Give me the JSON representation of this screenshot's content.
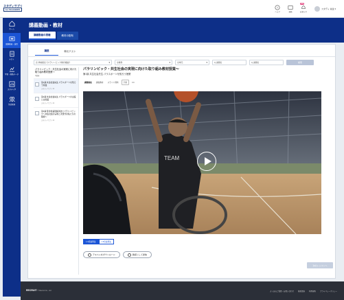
{
  "app": {
    "logo_line1": "スタディサプリ",
    "logo_line2": "for TEACHERS"
  },
  "topbar": {
    "icons": [
      {
        "name": "help-icon",
        "label": "ヘルプ"
      },
      {
        "name": "message-icon",
        "label": "連絡"
      },
      {
        "name": "notification-icon",
        "label": "お知らせ"
      }
    ],
    "badge": "999",
    "user_name": "スタディ 先生 ▾"
  },
  "sidebar": {
    "items": [
      {
        "label": "ホーム",
        "active": false
      },
      {
        "label": "講義動画・演習",
        "active": true
      },
      {
        "label": "テスト",
        "active": false
      },
      {
        "label": "学習・進路データ",
        "active": false
      },
      {
        "label": "スタディ学",
        "active": false
      },
      {
        "label": "生徒管理",
        "active": false
      }
    ]
  },
  "header": {
    "title": "講義動画・教材",
    "tabs": [
      {
        "label": "講義動画の視聴",
        "active": true
      },
      {
        "label": "教材の配布",
        "active": false
      }
    ]
  },
  "content_tabs": [
    {
      "label": "講座",
      "active": true
    },
    {
      "label": "単元テスト",
      "active": false
    }
  ],
  "filters": {
    "course": "高 学校探究【パラリンピック教育推進】",
    "f2": "全教科",
    "f3": "全単元",
    "q1": "Q 講座名",
    "q2": "Q 講座名",
    "search": "検索"
  },
  "left_list": {
    "course_title": "パラリンピック・共生社会の実現に向けた取り組み教材授業～",
    "course_sub": "3講座",
    "lessons": [
      {
        "title": "第1講 共生社会先生 パラスポーツを知ろう授業",
        "meta": "スタディサプリ 14"
      },
      {
        "title": "第2講 共生社会先生 パラスポーツの主役とは授業",
        "meta": "スタディサプリ 14"
      },
      {
        "title": "第3講 障害者差別解消法とパラリンピック～共生社会の実現と次世代の私たちの取組～",
        "meta": "スタディサプリ 14"
      }
    ]
  },
  "video": {
    "title": "パラリンピック・共生社会の実現に向けた取り組み教材授業～",
    "subtitle": "第1講 共生社会先生 パラスポーツを知ろう授業",
    "tab_labels": [
      "講義動画",
      "講義教材",
      "スライド資料",
      "字幕",
      "CC"
    ]
  },
  "speed": {
    "normal": "1.0倍速再生",
    "fast": "1.5倍速再生"
  },
  "actions": {
    "download": "テキストをダウンロード",
    "mail": "確認として送信"
  },
  "next_button": "次のレッスンへ",
  "footer": {
    "brand": "RECRUIT",
    "copy": "© Recruit Co., Ltd.",
    "links": [
      "よくあるご質問・お問い合わせ",
      "推奨環境",
      "利用規約",
      "プライバシーポリシー"
    ]
  }
}
